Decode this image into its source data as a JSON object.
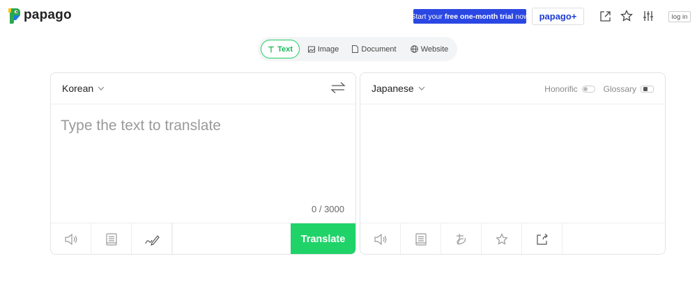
{
  "brand": {
    "name": "papago",
    "logo_colors": [
      "#2aa84f",
      "#1c7be0",
      "#f5c518"
    ]
  },
  "header": {
    "promo": {
      "prefix": "Start your",
      "bold": "free one-month trial",
      "suffix": "now"
    },
    "plus_label": "papago+",
    "icons": [
      "external-link-icon",
      "star-icon",
      "settings-sliders-icon"
    ],
    "login_label": "log in"
  },
  "tabs": [
    {
      "label": "Text",
      "icon": "text-icon",
      "active": true
    },
    {
      "label": "Image",
      "icon": "image-icon",
      "active": false
    },
    {
      "label": "Document",
      "icon": "document-icon",
      "active": false
    },
    {
      "label": "Website",
      "icon": "globe-icon",
      "active": false
    }
  ],
  "source": {
    "language": "Korean",
    "placeholder": "Type the text to translate",
    "counter": "0 / 3000",
    "footer_icons": [
      "speaker-icon",
      "dictionary-icon",
      "handwriting-icon"
    ],
    "translate_label": "Translate"
  },
  "target": {
    "language": "Japanese",
    "honorific_label": "Honorific",
    "glossary_label": "Glossary",
    "footer_icons": [
      "speaker-icon",
      "dictionary-icon",
      "pronunciation-icon",
      "star-icon",
      "share-icon"
    ]
  },
  "colors": {
    "accent_green": "#1fd368",
    "promo_blue": "#2b47e3",
    "plus_blue": "#1d3ad6"
  }
}
